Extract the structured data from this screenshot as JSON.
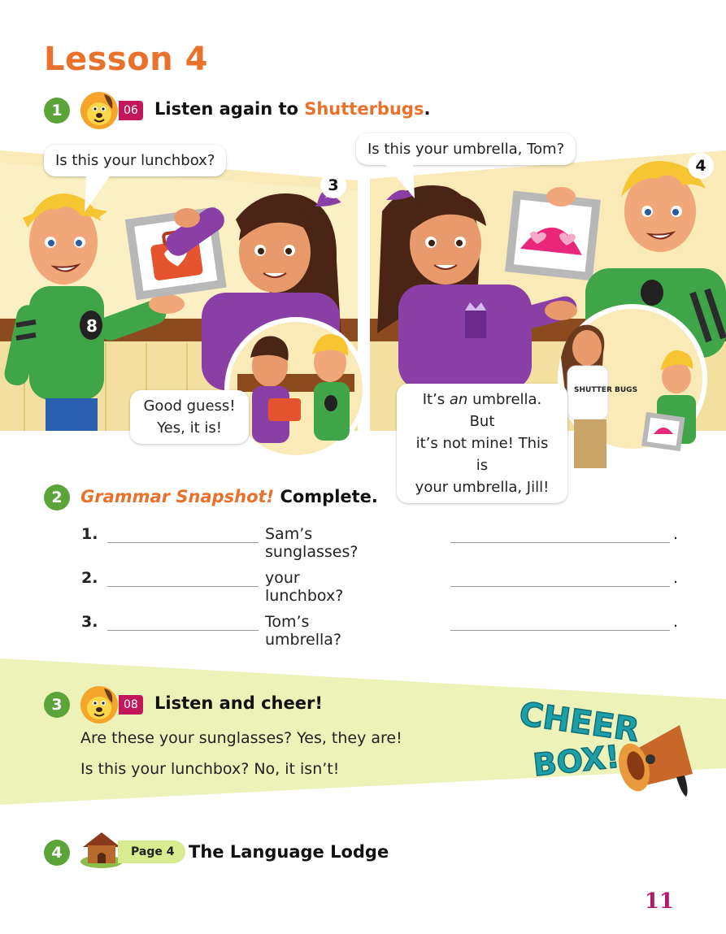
{
  "lesson": {
    "title": "Lesson 4"
  },
  "activity1": {
    "number": "1",
    "track": "06",
    "text": "Listen again to ",
    "highlight": "Shutterbugs",
    "period": "."
  },
  "comic": {
    "panel3_number": "3",
    "panel4_number": "4",
    "bubble1": "Is this your lunchbox?",
    "bubble2_line1": "Good guess!",
    "bubble2_line2": "Yes, it is!",
    "bubble3": "Is this your umbrella, Tom?",
    "bubble4_pre": "It’s ",
    "bubble4_em": "an",
    "bubble4_post": " umbrella. But",
    "bubble4_line2": "it’s not mine! This is",
    "bubble4_line3": "your umbrella, Jill!",
    "shirt_8": "8",
    "shirt_brand": "SHUTTER BUGS"
  },
  "activity2": {
    "number": "2",
    "title": "Grammar Snapshot!",
    "instruction": " Complete.",
    "items": [
      {
        "num": "1.",
        "text": "Sam’s sunglasses?",
        "end": "."
      },
      {
        "num": "2.",
        "text": "your lunchbox?",
        "end": "."
      },
      {
        "num": "3.",
        "text": "Tom’s umbrella?",
        "end": "."
      }
    ]
  },
  "activity3": {
    "number": "3",
    "track": "08",
    "title": "Listen and cheer!",
    "lines": [
      "Are these your sunglasses? Yes, they are!",
      "Is this your lunchbox? No, it isn’t!"
    ],
    "cheer_word1": "CHEER",
    "cheer_word2": "BOX!"
  },
  "activity4": {
    "number": "4",
    "page_label": "Page 4",
    "title": "The Language Lodge"
  },
  "footer": {
    "page_number": "11"
  },
  "colors": {
    "orange": "#e8712b",
    "green": "#5aa43a",
    "magenta": "#c2185b",
    "page_number": "#b01a6a",
    "band": "#ecf2b8"
  }
}
